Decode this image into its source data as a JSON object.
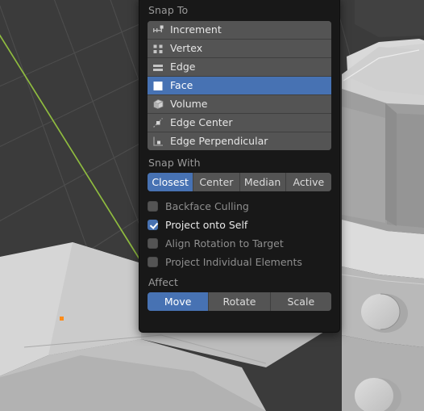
{
  "app": {
    "name": "blender-3d-viewport",
    "panel_title": "Snap Popover"
  },
  "viewport": {
    "name": "3d-viewport",
    "background_color": "#3b3b3b",
    "grid_color": "#4e4e4e",
    "y_axis_color": "#8fbc3f",
    "selected_vertex_color": "#ff8c1a",
    "mesh_light": "#d8d8d8",
    "mesh_mid": "#b4b4b4",
    "mesh_dark": "#9a9a9a"
  },
  "panel": {
    "background_color": "#181818",
    "accent_color": "#4772b3",
    "row_color": "#545454",
    "snap_to": {
      "label": "Snap To",
      "items": [
        {
          "label": "Increment",
          "icon": "snap-increment-icon",
          "selected": false
        },
        {
          "label": "Vertex",
          "icon": "snap-vertex-icon",
          "selected": false
        },
        {
          "label": "Edge",
          "icon": "snap-edge-icon",
          "selected": false
        },
        {
          "label": "Face",
          "icon": "snap-face-icon",
          "selected": true
        },
        {
          "label": "Volume",
          "icon": "snap-volume-icon",
          "selected": false
        },
        {
          "label": "Edge Center",
          "icon": "snap-edge-center-icon",
          "selected": false
        },
        {
          "label": "Edge Perpendicular",
          "icon": "snap-edge-perpendicular-icon",
          "selected": false
        }
      ]
    },
    "snap_with": {
      "label": "Snap With",
      "options": [
        {
          "label": "Closest",
          "active": true
        },
        {
          "label": "Center",
          "active": false
        },
        {
          "label": "Median",
          "active": false
        },
        {
          "label": "Active",
          "active": false
        }
      ]
    },
    "toggles": [
      {
        "label": "Backface Culling",
        "checked": false
      },
      {
        "label": "Project onto Self",
        "checked": true
      },
      {
        "label": "Align Rotation to Target",
        "checked": false
      },
      {
        "label": "Project Individual Elements",
        "checked": false
      }
    ],
    "affect": {
      "label": "Affect",
      "options": [
        {
          "label": "Move",
          "active": true
        },
        {
          "label": "Rotate",
          "active": false
        },
        {
          "label": "Scale",
          "active": false
        }
      ]
    }
  }
}
